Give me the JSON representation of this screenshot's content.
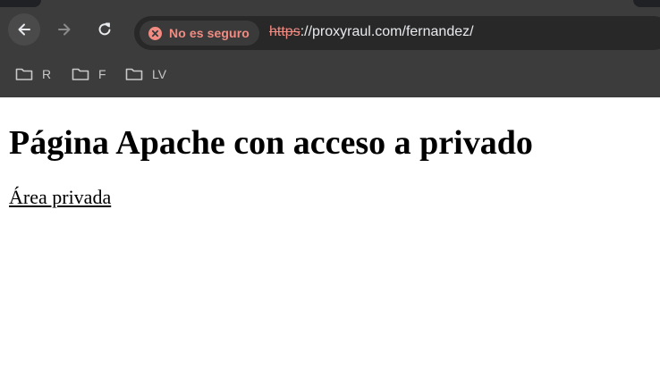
{
  "toolbar": {
    "security_chip_text": "No es seguro",
    "url_scheme": "https",
    "url_rest": "://proxyraul.com/fernandez/"
  },
  "bookmarks": [
    {
      "label": "R",
      "icon": "folder-icon"
    },
    {
      "label": "F",
      "icon": "folder-icon"
    },
    {
      "label": "LV",
      "icon": "folder-icon"
    }
  ],
  "page": {
    "heading": "Página Apache con acceso a privado",
    "link_text": "Área privada"
  },
  "colors": {
    "chrome_bg": "#3c3c3c",
    "omnibox_bg": "#282828",
    "warning": "#f28b82"
  }
}
